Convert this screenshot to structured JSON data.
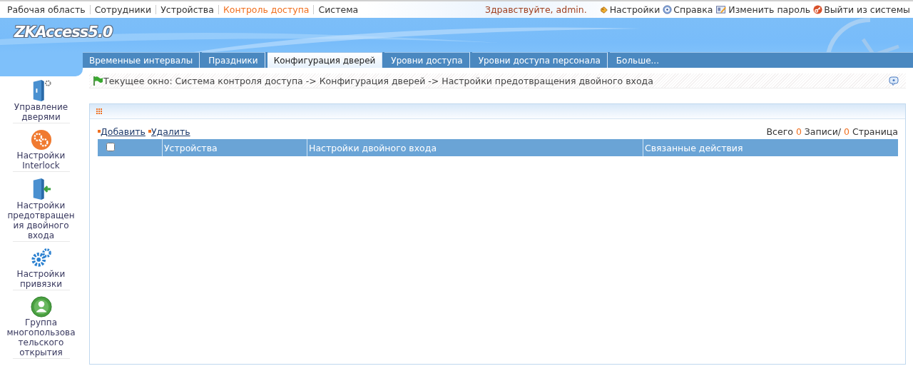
{
  "top_nav": [
    {
      "label": "Рабочая область",
      "selected": false
    },
    {
      "label": "Сотрудники",
      "selected": false
    },
    {
      "label": "Устройства",
      "selected": false
    },
    {
      "label": "Контроль доступа",
      "selected": true
    },
    {
      "label": "Система",
      "selected": false
    }
  ],
  "greeting": "Здравствуйте, admin.",
  "user_links": [
    {
      "kind": "settings",
      "label": "Настройки"
    },
    {
      "kind": "help",
      "label": "Справка"
    },
    {
      "kind": "password",
      "label": "Изменить пароль"
    },
    {
      "kind": "logout",
      "label": "Выйти из системы"
    }
  ],
  "logo": "ZKAccess5.0",
  "tabs": [
    {
      "label": "Временные интервалы",
      "selected": false
    },
    {
      "label": "Праздники",
      "selected": false
    },
    {
      "label": "Конфигурация дверей",
      "selected": true
    },
    {
      "label": "Уровни доступа",
      "selected": false
    },
    {
      "label": "Уровни доступа персонала",
      "selected": false
    },
    {
      "label": "Больше...",
      "selected": false
    }
  ],
  "sidebar": {
    "items": [
      {
        "kind": "door-gear",
        "label": "Управление дверями"
      },
      {
        "kind": "gears-orange",
        "label": "Настройки Interlock"
      },
      {
        "kind": "door-arrow",
        "label": "Настройки предотвращения двойного входа"
      },
      {
        "kind": "gears-blue",
        "label": "Настройки привязки"
      },
      {
        "kind": "group",
        "label": "Группа многопользовательского открытия"
      }
    ]
  },
  "breadcrumb": "Текущее окно: Система контроля доступа -> Конфигурация дверей -> Настройки предотвращения двойного входа",
  "actions": [
    "Добавить",
    "Удалить"
  ],
  "summary": {
    "prefix": "Всего",
    "records": "0",
    "middle": "Записи/",
    "pages": "0",
    "suffix": "Страница"
  },
  "table": {
    "select_all": {
      "checked": false
    },
    "columns": [
      "Устройства",
      "Настройки двойного входа",
      "Связанные действия"
    ]
  }
}
